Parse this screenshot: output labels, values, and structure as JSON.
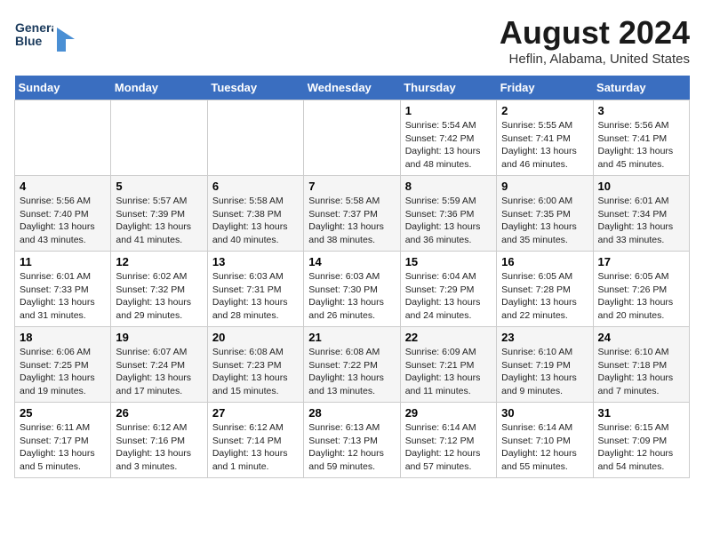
{
  "header": {
    "logo_line1": "General",
    "logo_line2": "Blue",
    "month_year": "August 2024",
    "location": "Heflin, Alabama, United States"
  },
  "weekdays": [
    "Sunday",
    "Monday",
    "Tuesday",
    "Wednesday",
    "Thursday",
    "Friday",
    "Saturday"
  ],
  "weeks": [
    [
      {
        "day": "",
        "info": ""
      },
      {
        "day": "",
        "info": ""
      },
      {
        "day": "",
        "info": ""
      },
      {
        "day": "",
        "info": ""
      },
      {
        "day": "1",
        "info": "Sunrise: 5:54 AM\nSunset: 7:42 PM\nDaylight: 13 hours\nand 48 minutes."
      },
      {
        "day": "2",
        "info": "Sunrise: 5:55 AM\nSunset: 7:41 PM\nDaylight: 13 hours\nand 46 minutes."
      },
      {
        "day": "3",
        "info": "Sunrise: 5:56 AM\nSunset: 7:41 PM\nDaylight: 13 hours\nand 45 minutes."
      }
    ],
    [
      {
        "day": "4",
        "info": "Sunrise: 5:56 AM\nSunset: 7:40 PM\nDaylight: 13 hours\nand 43 minutes."
      },
      {
        "day": "5",
        "info": "Sunrise: 5:57 AM\nSunset: 7:39 PM\nDaylight: 13 hours\nand 41 minutes."
      },
      {
        "day": "6",
        "info": "Sunrise: 5:58 AM\nSunset: 7:38 PM\nDaylight: 13 hours\nand 40 minutes."
      },
      {
        "day": "7",
        "info": "Sunrise: 5:58 AM\nSunset: 7:37 PM\nDaylight: 13 hours\nand 38 minutes."
      },
      {
        "day": "8",
        "info": "Sunrise: 5:59 AM\nSunset: 7:36 PM\nDaylight: 13 hours\nand 36 minutes."
      },
      {
        "day": "9",
        "info": "Sunrise: 6:00 AM\nSunset: 7:35 PM\nDaylight: 13 hours\nand 35 minutes."
      },
      {
        "day": "10",
        "info": "Sunrise: 6:01 AM\nSunset: 7:34 PM\nDaylight: 13 hours\nand 33 minutes."
      }
    ],
    [
      {
        "day": "11",
        "info": "Sunrise: 6:01 AM\nSunset: 7:33 PM\nDaylight: 13 hours\nand 31 minutes."
      },
      {
        "day": "12",
        "info": "Sunrise: 6:02 AM\nSunset: 7:32 PM\nDaylight: 13 hours\nand 29 minutes."
      },
      {
        "day": "13",
        "info": "Sunrise: 6:03 AM\nSunset: 7:31 PM\nDaylight: 13 hours\nand 28 minutes."
      },
      {
        "day": "14",
        "info": "Sunrise: 6:03 AM\nSunset: 7:30 PM\nDaylight: 13 hours\nand 26 minutes."
      },
      {
        "day": "15",
        "info": "Sunrise: 6:04 AM\nSunset: 7:29 PM\nDaylight: 13 hours\nand 24 minutes."
      },
      {
        "day": "16",
        "info": "Sunrise: 6:05 AM\nSunset: 7:28 PM\nDaylight: 13 hours\nand 22 minutes."
      },
      {
        "day": "17",
        "info": "Sunrise: 6:05 AM\nSunset: 7:26 PM\nDaylight: 13 hours\nand 20 minutes."
      }
    ],
    [
      {
        "day": "18",
        "info": "Sunrise: 6:06 AM\nSunset: 7:25 PM\nDaylight: 13 hours\nand 19 minutes."
      },
      {
        "day": "19",
        "info": "Sunrise: 6:07 AM\nSunset: 7:24 PM\nDaylight: 13 hours\nand 17 minutes."
      },
      {
        "day": "20",
        "info": "Sunrise: 6:08 AM\nSunset: 7:23 PM\nDaylight: 13 hours\nand 15 minutes."
      },
      {
        "day": "21",
        "info": "Sunrise: 6:08 AM\nSunset: 7:22 PM\nDaylight: 13 hours\nand 13 minutes."
      },
      {
        "day": "22",
        "info": "Sunrise: 6:09 AM\nSunset: 7:21 PM\nDaylight: 13 hours\nand 11 minutes."
      },
      {
        "day": "23",
        "info": "Sunrise: 6:10 AM\nSunset: 7:19 PM\nDaylight: 13 hours\nand 9 minutes."
      },
      {
        "day": "24",
        "info": "Sunrise: 6:10 AM\nSunset: 7:18 PM\nDaylight: 13 hours\nand 7 minutes."
      }
    ],
    [
      {
        "day": "25",
        "info": "Sunrise: 6:11 AM\nSunset: 7:17 PM\nDaylight: 13 hours\nand 5 minutes."
      },
      {
        "day": "26",
        "info": "Sunrise: 6:12 AM\nSunset: 7:16 PM\nDaylight: 13 hours\nand 3 minutes."
      },
      {
        "day": "27",
        "info": "Sunrise: 6:12 AM\nSunset: 7:14 PM\nDaylight: 13 hours\nand 1 minute."
      },
      {
        "day": "28",
        "info": "Sunrise: 6:13 AM\nSunset: 7:13 PM\nDaylight: 12 hours\nand 59 minutes."
      },
      {
        "day": "29",
        "info": "Sunrise: 6:14 AM\nSunset: 7:12 PM\nDaylight: 12 hours\nand 57 minutes."
      },
      {
        "day": "30",
        "info": "Sunrise: 6:14 AM\nSunset: 7:10 PM\nDaylight: 12 hours\nand 55 minutes."
      },
      {
        "day": "31",
        "info": "Sunrise: 6:15 AM\nSunset: 7:09 PM\nDaylight: 12 hours\nand 54 minutes."
      }
    ]
  ]
}
